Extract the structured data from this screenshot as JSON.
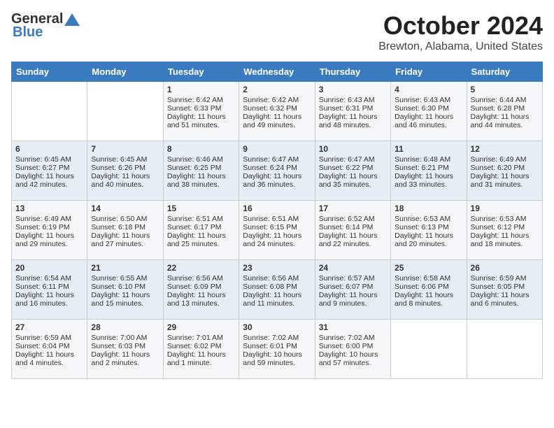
{
  "header": {
    "logo_general": "General",
    "logo_blue": "Blue",
    "month_title": "October 2024",
    "location": "Brewton, Alabama, United States"
  },
  "weekdays": [
    "Sunday",
    "Monday",
    "Tuesday",
    "Wednesday",
    "Thursday",
    "Friday",
    "Saturday"
  ],
  "weeks": [
    [
      {
        "day": "",
        "sunrise": "",
        "sunset": "",
        "daylight": ""
      },
      {
        "day": "",
        "sunrise": "",
        "sunset": "",
        "daylight": ""
      },
      {
        "day": "1",
        "sunrise": "Sunrise: 6:42 AM",
        "sunset": "Sunset: 6:33 PM",
        "daylight": "Daylight: 11 hours and 51 minutes."
      },
      {
        "day": "2",
        "sunrise": "Sunrise: 6:42 AM",
        "sunset": "Sunset: 6:32 PM",
        "daylight": "Daylight: 11 hours and 49 minutes."
      },
      {
        "day": "3",
        "sunrise": "Sunrise: 6:43 AM",
        "sunset": "Sunset: 6:31 PM",
        "daylight": "Daylight: 11 hours and 48 minutes."
      },
      {
        "day": "4",
        "sunrise": "Sunrise: 6:43 AM",
        "sunset": "Sunset: 6:30 PM",
        "daylight": "Daylight: 11 hours and 46 minutes."
      },
      {
        "day": "5",
        "sunrise": "Sunrise: 6:44 AM",
        "sunset": "Sunset: 6:28 PM",
        "daylight": "Daylight: 11 hours and 44 minutes."
      }
    ],
    [
      {
        "day": "6",
        "sunrise": "Sunrise: 6:45 AM",
        "sunset": "Sunset: 6:27 PM",
        "daylight": "Daylight: 11 hours and 42 minutes."
      },
      {
        "day": "7",
        "sunrise": "Sunrise: 6:45 AM",
        "sunset": "Sunset: 6:26 PM",
        "daylight": "Daylight: 11 hours and 40 minutes."
      },
      {
        "day": "8",
        "sunrise": "Sunrise: 6:46 AM",
        "sunset": "Sunset: 6:25 PM",
        "daylight": "Daylight: 11 hours and 38 minutes."
      },
      {
        "day": "9",
        "sunrise": "Sunrise: 6:47 AM",
        "sunset": "Sunset: 6:24 PM",
        "daylight": "Daylight: 11 hours and 36 minutes."
      },
      {
        "day": "10",
        "sunrise": "Sunrise: 6:47 AM",
        "sunset": "Sunset: 6:22 PM",
        "daylight": "Daylight: 11 hours and 35 minutes."
      },
      {
        "day": "11",
        "sunrise": "Sunrise: 6:48 AM",
        "sunset": "Sunset: 6:21 PM",
        "daylight": "Daylight: 11 hours and 33 minutes."
      },
      {
        "day": "12",
        "sunrise": "Sunrise: 6:49 AM",
        "sunset": "Sunset: 6:20 PM",
        "daylight": "Daylight: 11 hours and 31 minutes."
      }
    ],
    [
      {
        "day": "13",
        "sunrise": "Sunrise: 6:49 AM",
        "sunset": "Sunset: 6:19 PM",
        "daylight": "Daylight: 11 hours and 29 minutes."
      },
      {
        "day": "14",
        "sunrise": "Sunrise: 6:50 AM",
        "sunset": "Sunset: 6:18 PM",
        "daylight": "Daylight: 11 hours and 27 minutes."
      },
      {
        "day": "15",
        "sunrise": "Sunrise: 6:51 AM",
        "sunset": "Sunset: 6:17 PM",
        "daylight": "Daylight: 11 hours and 25 minutes."
      },
      {
        "day": "16",
        "sunrise": "Sunrise: 6:51 AM",
        "sunset": "Sunset: 6:15 PM",
        "daylight": "Daylight: 11 hours and 24 minutes."
      },
      {
        "day": "17",
        "sunrise": "Sunrise: 6:52 AM",
        "sunset": "Sunset: 6:14 PM",
        "daylight": "Daylight: 11 hours and 22 minutes."
      },
      {
        "day": "18",
        "sunrise": "Sunrise: 6:53 AM",
        "sunset": "Sunset: 6:13 PM",
        "daylight": "Daylight: 11 hours and 20 minutes."
      },
      {
        "day": "19",
        "sunrise": "Sunrise: 6:53 AM",
        "sunset": "Sunset: 6:12 PM",
        "daylight": "Daylight: 11 hours and 18 minutes."
      }
    ],
    [
      {
        "day": "20",
        "sunrise": "Sunrise: 6:54 AM",
        "sunset": "Sunset: 6:11 PM",
        "daylight": "Daylight: 11 hours and 16 minutes."
      },
      {
        "day": "21",
        "sunrise": "Sunrise: 6:55 AM",
        "sunset": "Sunset: 6:10 PM",
        "daylight": "Daylight: 11 hours and 15 minutes."
      },
      {
        "day": "22",
        "sunrise": "Sunrise: 6:56 AM",
        "sunset": "Sunset: 6:09 PM",
        "daylight": "Daylight: 11 hours and 13 minutes."
      },
      {
        "day": "23",
        "sunrise": "Sunrise: 6:56 AM",
        "sunset": "Sunset: 6:08 PM",
        "daylight": "Daylight: 11 hours and 11 minutes."
      },
      {
        "day": "24",
        "sunrise": "Sunrise: 6:57 AM",
        "sunset": "Sunset: 6:07 PM",
        "daylight": "Daylight: 11 hours and 9 minutes."
      },
      {
        "day": "25",
        "sunrise": "Sunrise: 6:58 AM",
        "sunset": "Sunset: 6:06 PM",
        "daylight": "Daylight: 11 hours and 8 minutes."
      },
      {
        "day": "26",
        "sunrise": "Sunrise: 6:59 AM",
        "sunset": "Sunset: 6:05 PM",
        "daylight": "Daylight: 11 hours and 6 minutes."
      }
    ],
    [
      {
        "day": "27",
        "sunrise": "Sunrise: 6:59 AM",
        "sunset": "Sunset: 6:04 PM",
        "daylight": "Daylight: 11 hours and 4 minutes."
      },
      {
        "day": "28",
        "sunrise": "Sunrise: 7:00 AM",
        "sunset": "Sunset: 6:03 PM",
        "daylight": "Daylight: 11 hours and 2 minutes."
      },
      {
        "day": "29",
        "sunrise": "Sunrise: 7:01 AM",
        "sunset": "Sunset: 6:02 PM",
        "daylight": "Daylight: 11 hours and 1 minute."
      },
      {
        "day": "30",
        "sunrise": "Sunrise: 7:02 AM",
        "sunset": "Sunset: 6:01 PM",
        "daylight": "Daylight: 10 hours and 59 minutes."
      },
      {
        "day": "31",
        "sunrise": "Sunrise: 7:02 AM",
        "sunset": "Sunset: 6:00 PM",
        "daylight": "Daylight: 10 hours and 57 minutes."
      },
      {
        "day": "",
        "sunrise": "",
        "sunset": "",
        "daylight": ""
      },
      {
        "day": "",
        "sunrise": "",
        "sunset": "",
        "daylight": ""
      }
    ]
  ]
}
